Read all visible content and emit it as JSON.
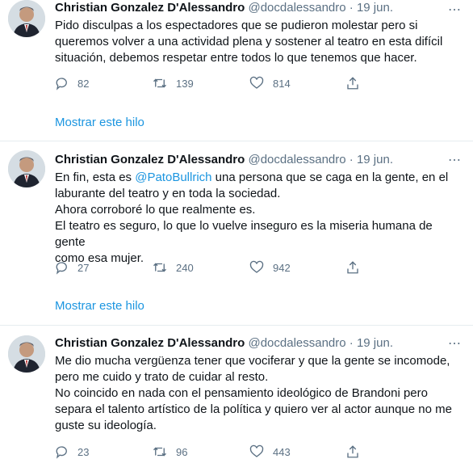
{
  "tweets": [
    {
      "name": "Christian Gonzalez D'Alessandro",
      "handle": "@docdalessandro",
      "separator": "·",
      "date": "19 jun.",
      "text": "Pido disculpas a los espectadores que se pudieron molestar pero si\nqueremos volver a una actividad plena y sostener al teatro en esta difícil\nsituación, debemos respetar entre todos lo que tenemos que hacer.",
      "replies": "82",
      "retweets": "139",
      "likes": "814",
      "thread_label": "Mostrar este hilo"
    },
    {
      "name": "Christian Gonzalez D'Alessandro",
      "handle": "@docdalessandro",
      "separator": "·",
      "date": "19 jun.",
      "text_before": "En fin, esta es ",
      "mention": "@PatoBullrich",
      "text_after": " una persona que se caga en la gente, en el\nlaburante del teatro y en toda la sociedad.\nAhora corroboré lo que realmente es.\nEl teatro es seguro, lo que lo vuelve inseguro es la miseria humana de gente\ncomo esa mujer.",
      "replies": "27",
      "retweets": "240",
      "likes": "942",
      "thread_label": "Mostrar este hilo"
    },
    {
      "name": "Christian Gonzalez D'Alessandro",
      "handle": "@docdalessandro",
      "separator": "·",
      "date": "19 jun.",
      "text": "Me dio mucha vergüenza tener que vociferar y que la gente se incomode,\npero me cuido y trato de cuidar al resto.\nNo coincido en nada con el pensamiento ideológico de Brandoni pero\nsepara el talento artístico de la política y quiero ver al actor aunque no me\nguste su ideología.",
      "replies": "23",
      "retweets": "96",
      "likes": "443"
    }
  ],
  "colors": {
    "link": "#1b95e0",
    "muted": "#5b7083",
    "text": "#0f1419",
    "divider": "#e6ecf0"
  },
  "icons": {
    "reply": "reply-icon",
    "retweet": "retweet-icon",
    "like": "heart-icon",
    "share": "share-icon",
    "more": "more-options-icon"
  }
}
